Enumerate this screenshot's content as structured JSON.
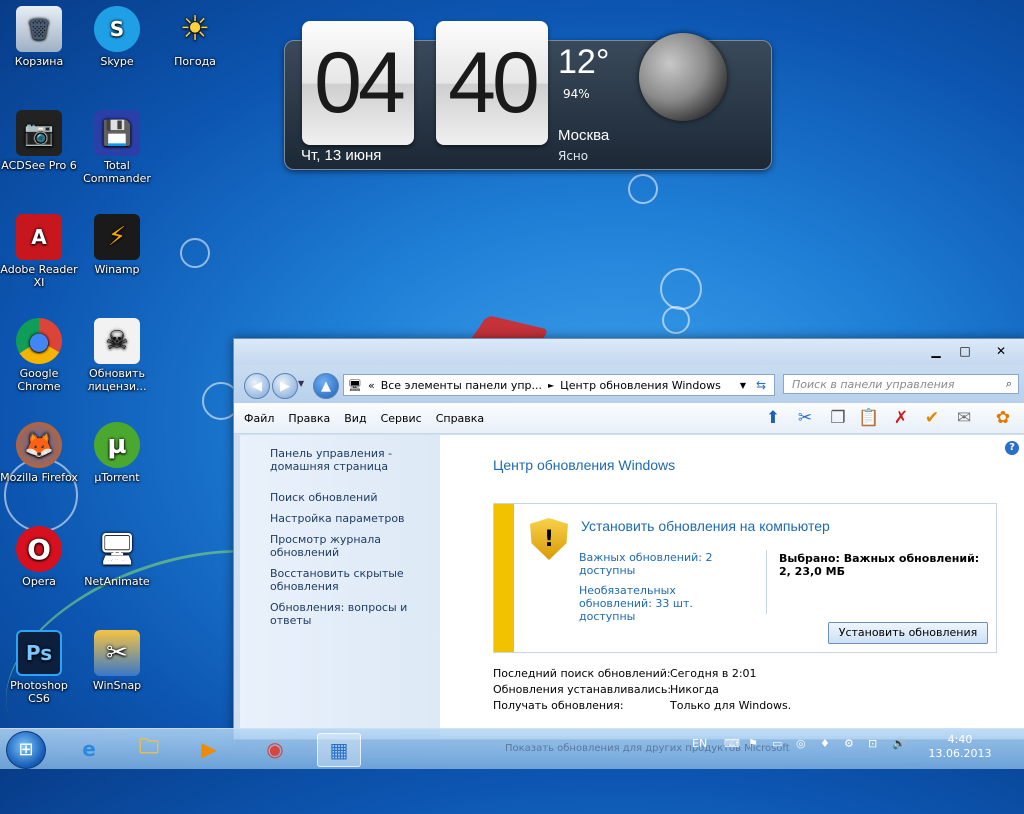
{
  "desktop": {
    "icons": [
      {
        "label": "Корзина",
        "glyph": "🗑"
      },
      {
        "label": "Skype",
        "glyph": "S"
      },
      {
        "label": "Погода",
        "glyph": "☀"
      },
      {
        "label": "ACDSee Pro 6",
        "glyph": "📷"
      },
      {
        "label": "Total Commander",
        "glyph": "💾"
      },
      {
        "label": "Adobe Reader XI",
        "glyph": "A"
      },
      {
        "label": "Winamp",
        "glyph": "⚡"
      },
      {
        "label": "Google Chrome",
        "glyph": "●"
      },
      {
        "label": "Обновить лицензи...",
        "glyph": "☠"
      },
      {
        "label": "Mozilla Firefox",
        "glyph": "🦊"
      },
      {
        "label": "µTorrent",
        "glyph": "µ"
      },
      {
        "label": "Opera",
        "glyph": "O"
      },
      {
        "label": "NetAnimate",
        "glyph": "🖥"
      },
      {
        "label": "Photoshop CS6",
        "glyph": "Ps"
      },
      {
        "label": "WinSnap",
        "glyph": "✂"
      }
    ]
  },
  "gadget": {
    "hours": "04",
    "minutes": "40",
    "date": "Чт, 13 июня",
    "temperature": "12°",
    "humidity": "94%",
    "city": "Москва",
    "condition": "Ясно"
  },
  "window": {
    "address": {
      "prefix": "«",
      "segment1": "Все элементы панели упр...",
      "separator": "►",
      "segment2": "Центр обновления Windows"
    },
    "search_placeholder": "Поиск в панели управления",
    "menu": [
      "Файл",
      "Правка",
      "Вид",
      "Сервис",
      "Справка"
    ],
    "left_links": [
      "Панель управления - домашняя страница",
      "Поиск обновлений",
      "Настройка параметров",
      "Просмотр журнала обновлений",
      "Восстановить скрытые обновления",
      "Обновления: вопросы и ответы"
    ],
    "heading": "Центр обновления Windows",
    "update_box": {
      "title": "Установить обновления на компьютер",
      "important": "Важных обновлений: 2 доступны",
      "optional": "Необязательных обновлений: 33 шт. доступны",
      "selected": "Выбрано: Важных обновлений: 2, 23,0 МБ",
      "install_button": "Установить обновления"
    },
    "info": [
      {
        "label": "Последний поиск обновлений:",
        "value": "Сегодня в 2:01"
      },
      {
        "label": "Обновления устанавливались:",
        "value": "Никогда"
      },
      {
        "label": "Получать обновления:",
        "value": "Только для Windows."
      }
    ]
  },
  "taskbar": {
    "language": "EN",
    "time": "4:40",
    "date": "13.06.2013",
    "faded_text": "Показать обновления для других продуктов Microsoft"
  }
}
